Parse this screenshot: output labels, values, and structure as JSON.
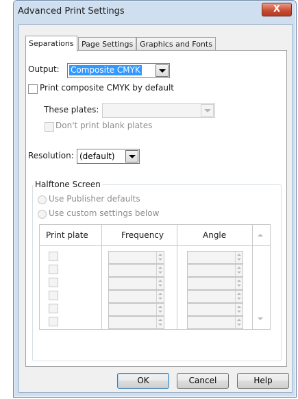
{
  "window": {
    "title": "Advanced Print Settings",
    "close_label": "X"
  },
  "tabs": [
    {
      "label": "Separations",
      "active": true
    },
    {
      "label": "Page Settings",
      "active": false
    },
    {
      "label": "Graphics and Fonts",
      "active": false
    }
  ],
  "output": {
    "label": "Output:",
    "value": "Composite CMYK"
  },
  "composite_default": {
    "label": "Print composite CMYK by default",
    "checked": false
  },
  "plates": {
    "label": "These plates:",
    "value": ""
  },
  "blank_plates": {
    "label": "Don't print blank plates",
    "checked": false,
    "enabled": false
  },
  "resolution": {
    "label": "Resolution:",
    "value": "(default)"
  },
  "halftone": {
    "title": "Halftone Screen",
    "option_publisher": "Use Publisher defaults",
    "option_custom": "Use custom settings below",
    "columns": [
      "Print plate",
      "Frequency",
      "Angle"
    ],
    "row_count": 6
  },
  "buttons": {
    "ok": "OK",
    "cancel": "Cancel",
    "help": "Help"
  },
  "colors": {
    "titlebar": "#cfdff0",
    "close": "#c84a32",
    "selection": "#3399ff"
  }
}
